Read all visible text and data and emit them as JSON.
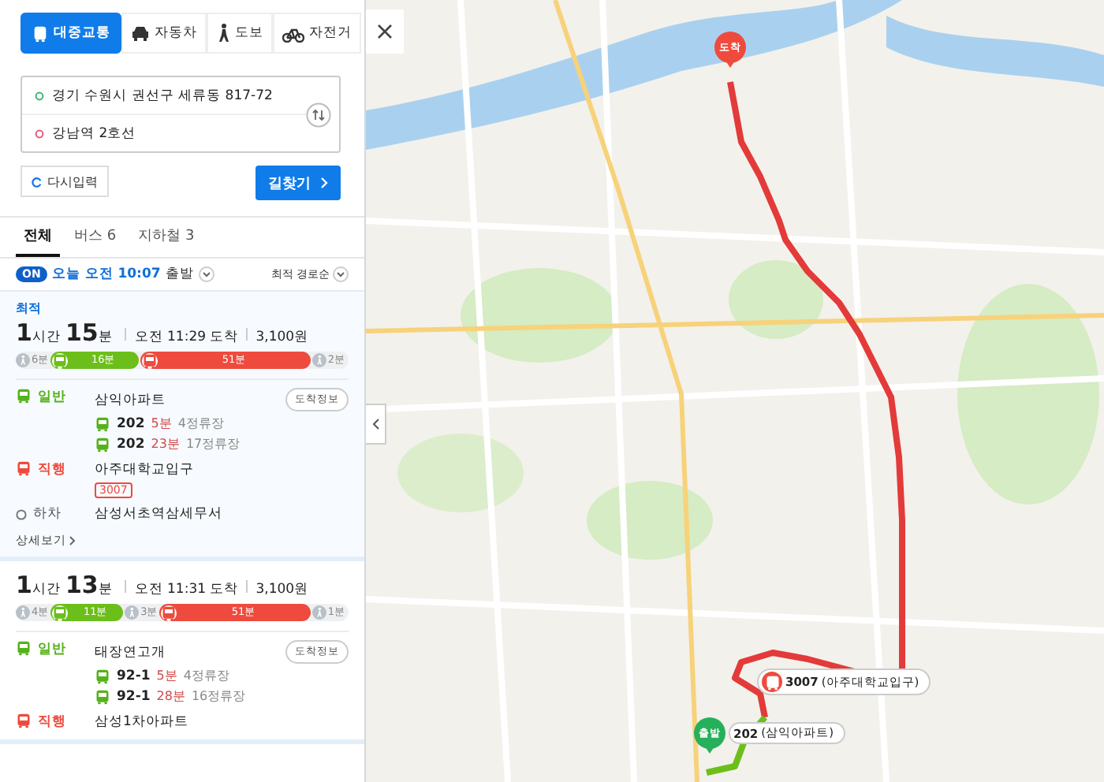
{
  "mode_tabs": [
    {
      "label": "대중교통",
      "kind": "transit",
      "selected": true
    },
    {
      "label": "자동차",
      "kind": "car",
      "selected": false
    },
    {
      "label": "도보",
      "kind": "walk",
      "selected": false
    },
    {
      "label": "자전거",
      "kind": "bike",
      "selected": false
    }
  ],
  "search": {
    "origin": "경기 수원시 권선구 세류동 817-72",
    "destination": "강남역 2호선",
    "reset_button": "다시입력",
    "search_button": "길찾기"
  },
  "filter_tabs": [
    {
      "label": "전체",
      "selected": true
    },
    {
      "label": "버스 6",
      "selected": false
    },
    {
      "label": "지하철 3",
      "selected": false
    }
  ],
  "departure": {
    "badge": "ON",
    "time": "오늘 오전 10:07",
    "suffix": "출발",
    "sort": "최적 경로순"
  },
  "routes": [
    {
      "tag": "최적",
      "hours": "1",
      "hours_unit": "시간",
      "minutes": "15",
      "minutes_unit": "분",
      "arrival": "오전 11:29 도착",
      "fare": "3,100원",
      "segments": [
        {
          "kind": "walk",
          "label": "6분"
        },
        {
          "kind": "bus",
          "label": "16분",
          "color": "#6cbf1a"
        },
        {
          "kind": "bus",
          "label": "51분",
          "color": "#ee4b3e"
        },
        {
          "kind": "walk",
          "label": "2분"
        }
      ],
      "steps": [
        {
          "kind": "general",
          "type_label": "일반",
          "stop": "삼익아파트",
          "info_button": "도착정보",
          "buses": [
            {
              "number": "202",
              "eta": "5분",
              "stops": "4정류장"
            },
            {
              "number": "202",
              "eta": "23분",
              "stops": "17정류장"
            }
          ]
        },
        {
          "kind": "express",
          "type_label": "직행",
          "stop": "아주대학교입구",
          "badges": [
            "3007"
          ]
        },
        {
          "kind": "alight",
          "type_label": "하차",
          "stop": "삼성서초역삼세무서"
        }
      ],
      "more": "상세보기"
    },
    {
      "hours": "1",
      "hours_unit": "시간",
      "minutes": "13",
      "minutes_unit": "분",
      "arrival": "오전 11:31 도착",
      "fare": "3,100원",
      "segments": [
        {
          "kind": "walk",
          "label": "4분"
        },
        {
          "kind": "bus",
          "label": "11분",
          "color": "#6cbf1a"
        },
        {
          "kind": "walk",
          "label": "3분"
        },
        {
          "kind": "bus",
          "label": "51분",
          "color": "#ee4b3e"
        },
        {
          "kind": "walk",
          "label": "1분"
        }
      ],
      "steps": [
        {
          "kind": "general",
          "type_label": "일반",
          "stop": "태장연고개",
          "info_button": "도착정보",
          "buses": [
            {
              "number": "92-1",
              "eta": "5분",
              "stops": "4정류장"
            },
            {
              "number": "92-1",
              "eta": "28분",
              "stops": "16정류장"
            }
          ]
        },
        {
          "kind": "express",
          "type_label": "직행",
          "stop": "삼성1차아파트"
        }
      ]
    }
  ],
  "map": {
    "destination_pin": "도착",
    "origin_pin": "출발",
    "stop_labels": [
      {
        "kind": "express",
        "number": "3007",
        "name": "(아주대학교입구)"
      },
      {
        "kind": "general",
        "number": "202",
        "name": "(삼익아파트)"
      }
    ]
  }
}
